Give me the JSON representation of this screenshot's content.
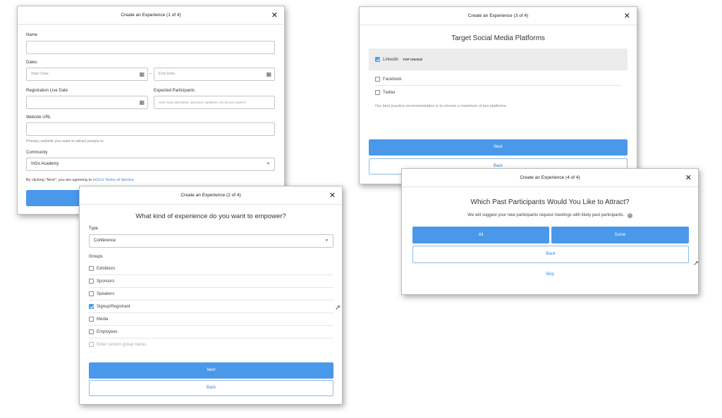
{
  "step1": {
    "title": "Create an Experience (1 of 4)",
    "close": "✕",
    "name_label": "Name",
    "name_value": "",
    "dates_label": "Dates",
    "start_placeholder": "Start Date",
    "date_separator": "–",
    "end_placeholder": "End Date",
    "reg_label": "Registration Live Date",
    "reg_value": "",
    "participants_label": "Expected Participants",
    "participants_placeholder": "How many attendees, sponsors, speakers, etc do you expect?",
    "website_label": "Website URL",
    "website_value": "",
    "website_hint": "Primary website you want to attract people to",
    "community_label": "Community",
    "community_value": "InGo Academy",
    "terms_prefix": "By clicking \"Next\", you are agreeing to ",
    "terms_link": "InGo's Terms of Service",
    "calendar_icon": "calendar-icon",
    "caret_icon": "chevron-down-icon"
  },
  "step2": {
    "title": "Create an Experience (2 of 4)",
    "close": "✕",
    "heading": "What kind of experience do you want to empower?",
    "type_label": "Type",
    "type_value": "Conference",
    "groups_label": "Groups",
    "groups": [
      {
        "label": "Exhibitors",
        "checked": false
      },
      {
        "label": "Sponsors",
        "checked": false
      },
      {
        "label": "Speakers",
        "checked": false
      },
      {
        "label": "Signup/Registrant",
        "checked": true
      },
      {
        "label": "Media",
        "checked": false
      },
      {
        "label": "Employees",
        "checked": false
      }
    ],
    "custom_group_placeholder": "Enter custom group name...",
    "next_label": "Next",
    "back_label": "Back"
  },
  "step3": {
    "title": "Create an Experience (3 of 4)",
    "close": "✕",
    "heading": "Target Social Media Platforms",
    "platforms": [
      {
        "label": "Linkedin",
        "checked": true,
        "badge": "TOP CHOICE"
      },
      {
        "label": "Facebook",
        "checked": false,
        "badge": ""
      },
      {
        "label": "Twitter",
        "checked": false,
        "badge": ""
      }
    ],
    "recommendation": "Our best practice recommendation is to choose a maximum of two platforms.",
    "next_label": "Next",
    "back_label": "Back"
  },
  "step4": {
    "title": "Create an Experience (4 of 4)",
    "close": "✕",
    "heading": "Which Past Participants Would You Like to Attract?",
    "subtext": "We will suggest your new participants request meetings with likely past participants.",
    "info_icon": "info-icon",
    "all_label": "All",
    "some_label": "Some",
    "back_label": "Back",
    "skip_label": "Skip"
  },
  "colors": {
    "primary": "#4a98e9",
    "link": "#3b82d8",
    "accent": "#e4b84a"
  }
}
